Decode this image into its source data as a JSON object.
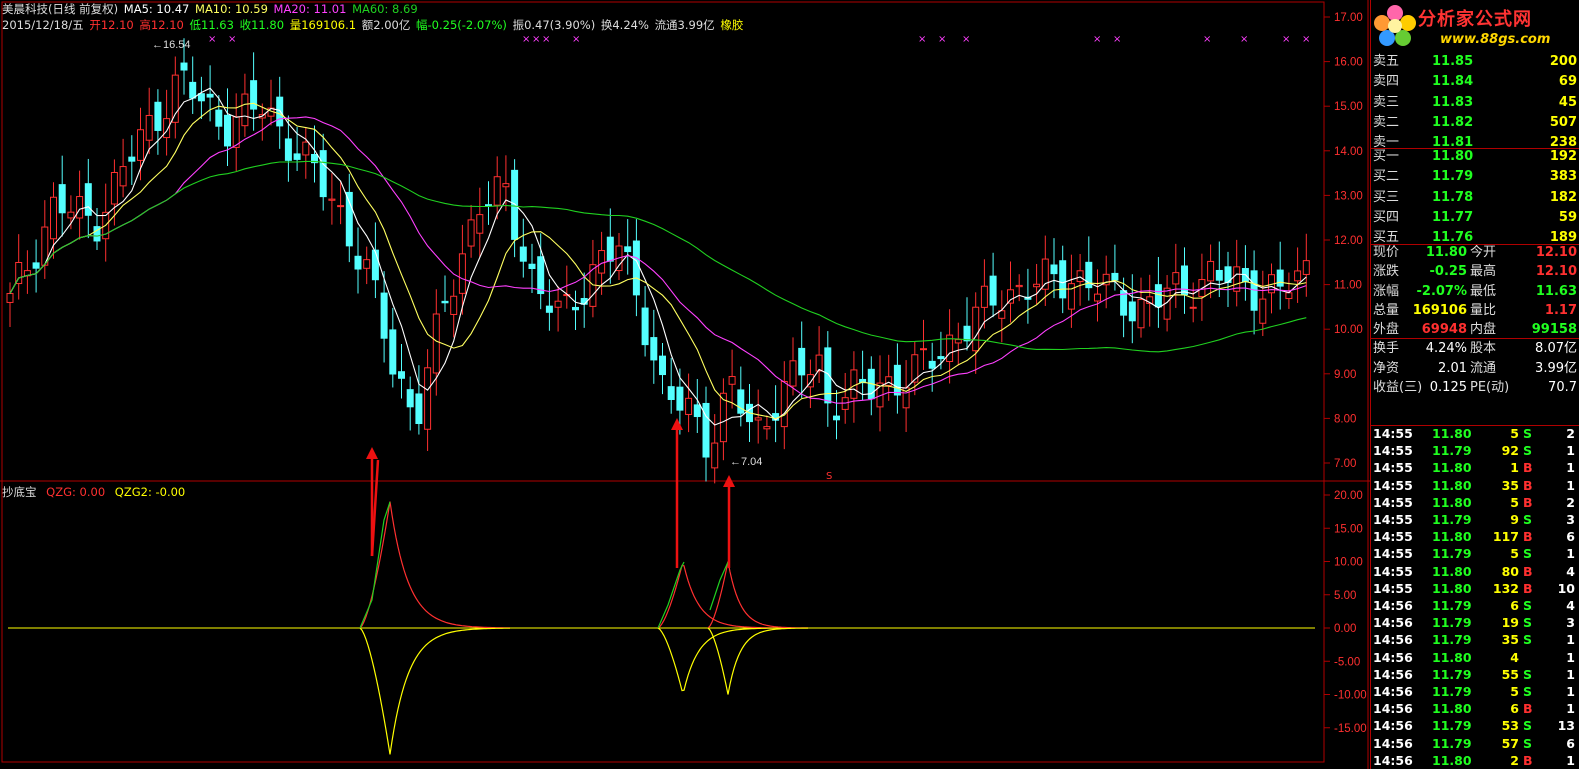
{
  "colors": {
    "up": "#ff3030",
    "down": "#54ffff",
    "ma5": "#ffffff",
    "ma10": "#ffff60",
    "ma20": "#ff40ff",
    "ma60": "#20d020",
    "grid": "#b00000",
    "yellow": "#ffff00",
    "green": "#20ff20",
    "red": "#ff3030"
  },
  "header": {
    "stock_name": "美晨科技(日线 前复权)",
    "ma5": "MA5: 10.47",
    "ma10": "MA10: 10.59",
    "ma20": "MA20: 11.01",
    "ma60": "MA60: 8.69",
    "date": "2015/12/18/五",
    "open": "开12.10",
    "high": "高12.10",
    "low": "低11.63",
    "close": "收11.80",
    "volume": "量169106.1",
    "amount": "额2.00亿",
    "change": "幅-0.25(-2.07%)",
    "amplitude": "振0.47(3.90%)",
    "turnover": "换4.24%",
    "float": "流通3.99亿",
    "concept": "橡胶"
  },
  "main_chart": {
    "y_axis": [
      "17.00",
      "16.00",
      "15.00",
      "14.00",
      "13.00",
      "12.00",
      "11.00",
      "10.00",
      "9.00",
      "8.00",
      "7.00"
    ],
    "high_label": "16.54",
    "low_label": "7.04",
    "marker_glyph": "×",
    "s_mark": "S"
  },
  "indicator": {
    "name": "抄底宝",
    "qzg": "QZG: 0.00",
    "qzg2": "QZG2: -0.00",
    "y_axis": [
      "20.00",
      "15.00",
      "10.00",
      "5.00",
      "0.00",
      "-5.00",
      "-10.00",
      "-15.00"
    ]
  },
  "logo": {
    "title": "分析家公式网",
    "url": "www.88gs.com"
  },
  "order_book": {
    "asks": [
      {
        "label": "卖五",
        "price": "11.85",
        "vol": "200"
      },
      {
        "label": "卖四",
        "price": "11.84",
        "vol": "69"
      },
      {
        "label": "卖三",
        "price": "11.83",
        "vol": "45"
      },
      {
        "label": "卖二",
        "price": "11.82",
        "vol": "507"
      },
      {
        "label": "卖一",
        "price": "11.81",
        "vol": "238"
      }
    ],
    "bids": [
      {
        "label": "买一",
        "price": "11.80",
        "vol": "192"
      },
      {
        "label": "买二",
        "price": "11.79",
        "vol": "383"
      },
      {
        "label": "买三",
        "price": "11.78",
        "vol": "182"
      },
      {
        "label": "买四",
        "price": "11.77",
        "vol": "59"
      },
      {
        "label": "买五",
        "price": "11.76",
        "vol": "189"
      }
    ]
  },
  "quote": [
    {
      "l1": "现价",
      "v1": "11.80",
      "l2": "今开",
      "v2": "12.10"
    },
    {
      "l1": "涨跌",
      "v1": "-0.25",
      "l2": "最高",
      "v2": "12.10"
    },
    {
      "l1": "涨幅",
      "v1": "-2.07%",
      "l2": "最低",
      "v2": "11.63"
    },
    {
      "l1": "总量",
      "v1": "169106",
      "l2": "量比",
      "v2": "1.17"
    },
    {
      "l1": "外盘",
      "v1": "69948",
      "l2": "内盘",
      "v2": "99158"
    }
  ],
  "stats": [
    {
      "l1": "换手",
      "v1": "4.24%",
      "l2": "股本",
      "v2": "8.07亿"
    },
    {
      "l1": "净资",
      "v1": "2.01",
      "l2": "流通",
      "v2": "3.99亿"
    },
    {
      "l1": "收益(三)",
      "v1": "0.125",
      "l2": "PE(动)",
      "v2": "70.7"
    }
  ],
  "ticks": [
    {
      "t": "14:55",
      "p": "11.80",
      "v": "5",
      "s": "S",
      "n": "2"
    },
    {
      "t": "14:55",
      "p": "11.79",
      "v": "92",
      "s": "S",
      "n": "1"
    },
    {
      "t": "14:55",
      "p": "11.80",
      "v": "1",
      "s": "B",
      "n": "1"
    },
    {
      "t": "14:55",
      "p": "11.80",
      "v": "35",
      "s": "B",
      "n": "1"
    },
    {
      "t": "14:55",
      "p": "11.80",
      "v": "5",
      "s": "B",
      "n": "2"
    },
    {
      "t": "14:55",
      "p": "11.79",
      "v": "9",
      "s": "S",
      "n": "3"
    },
    {
      "t": "14:55",
      "p": "11.80",
      "v": "117",
      "s": "B",
      "n": "6"
    },
    {
      "t": "14:55",
      "p": "11.79",
      "v": "5",
      "s": "S",
      "n": "1"
    },
    {
      "t": "14:55",
      "p": "11.80",
      "v": "80",
      "s": "B",
      "n": "4"
    },
    {
      "t": "14:55",
      "p": "11.80",
      "v": "132",
      "s": "B",
      "n": "10"
    },
    {
      "t": "14:56",
      "p": "11.79",
      "v": "6",
      "s": "S",
      "n": "4"
    },
    {
      "t": "14:56",
      "p": "11.79",
      "v": "19",
      "s": "S",
      "n": "3"
    },
    {
      "t": "14:56",
      "p": "11.79",
      "v": "35",
      "s": "S",
      "n": "1"
    },
    {
      "t": "14:56",
      "p": "11.80",
      "v": "4",
      "s": "",
      "n": "1"
    },
    {
      "t": "14:56",
      "p": "11.79",
      "v": "55",
      "s": "S",
      "n": "1"
    },
    {
      "t": "14:56",
      "p": "11.79",
      "v": "5",
      "s": "S",
      "n": "1"
    },
    {
      "t": "14:56",
      "p": "11.80",
      "v": "6",
      "s": "B",
      "n": "1"
    },
    {
      "t": "14:56",
      "p": "11.79",
      "v": "53",
      "s": "S",
      "n": "13"
    },
    {
      "t": "14:56",
      "p": "11.79",
      "v": "57",
      "s": "S",
      "n": "6"
    },
    {
      "t": "14:56",
      "p": "11.80",
      "v": "2",
      "s": "B",
      "n": "1"
    }
  ]
}
